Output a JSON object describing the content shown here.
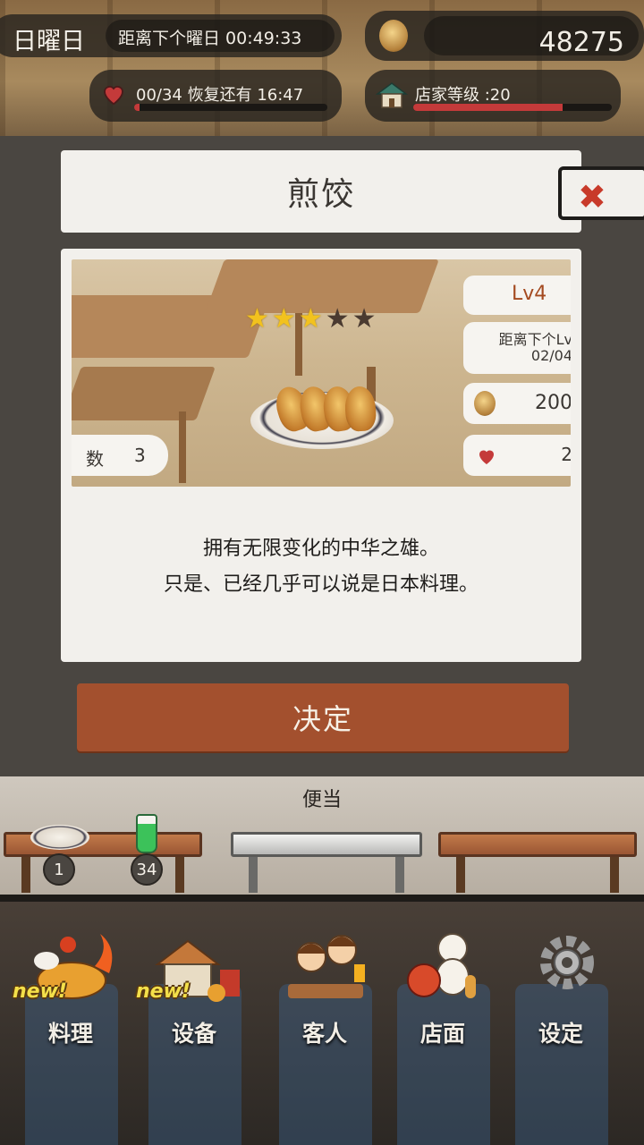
{
  "hud": {
    "day_name": "日曜日",
    "day_countdown": "距离下个曜日 00:49:33",
    "coins": "48275",
    "hearts_text": "00/34  恢复还有  16:47",
    "hearts_progress": 0.03,
    "shop_level_text": "店家等级 :20",
    "shop_level_progress": 0.75
  },
  "dialog": {
    "title": "煎饺",
    "stars_filled": 3,
    "stars_total": 5,
    "level": "Lv4",
    "next_level_label": "距离下个Lv",
    "next_level_value": "02/04",
    "price": "200",
    "hearts": "2",
    "count_label": "数",
    "count_value": "3",
    "description_line1": "拥有无限变化的中华之雄。",
    "description_line2": "只是、已经几乎可以说是日本料理。",
    "confirm_label": "决定",
    "close_icon": "close-icon"
  },
  "counter": {
    "section_label": "便当",
    "items": [
      {
        "icon": "gyoza-dish-icon",
        "quantity": "1"
      },
      {
        "icon": "melon-soda-icon",
        "quantity": "34"
      }
    ]
  },
  "nav": {
    "items": [
      {
        "label": "料理",
        "icon": "cooking-icon",
        "new": true
      },
      {
        "label": "设备",
        "icon": "equipment-icon",
        "new": true
      },
      {
        "label": "客人",
        "icon": "customers-icon",
        "new": false
      },
      {
        "label": "店面",
        "icon": "storefront-icon",
        "new": false
      },
      {
        "label": "设定",
        "icon": "settings-gear-icon",
        "new": false
      }
    ],
    "new_tag": "new!"
  },
  "colors": {
    "accent_button": "#a3502e",
    "close_x": "#c83a2a",
    "star_on": "#f2c21e",
    "heart": "#c43a3a"
  }
}
